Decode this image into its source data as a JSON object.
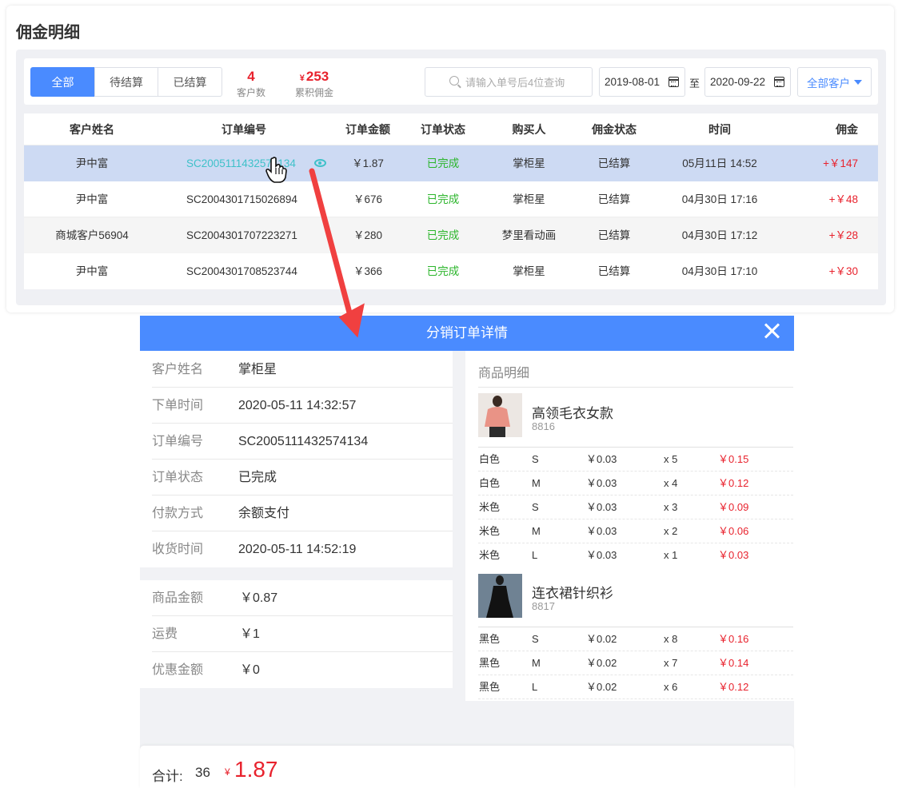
{
  "page_title": "佣金明细",
  "tabs": [
    {
      "label": "全部",
      "active": true
    },
    {
      "label": "待结算",
      "active": false
    },
    {
      "label": "已结算",
      "active": false
    }
  ],
  "stats": {
    "customers": {
      "value": "4",
      "label": "客户数"
    },
    "commission": {
      "currency": "¥",
      "value": "253",
      "label": "累积佣金"
    }
  },
  "search": {
    "placeholder": "请输入单号后4位查询"
  },
  "date_range": {
    "start": "2019-08-01",
    "separator": "至",
    "end": "2020-09-22"
  },
  "customer_filter": {
    "selected": "全部客户"
  },
  "table": {
    "headers": [
      "客户姓名",
      "订单编号",
      "订单金额",
      "订单状态",
      "购买人",
      "佣金状态",
      "时间",
      "佣金"
    ],
    "rows": [
      {
        "name": "尹中富",
        "order": "SC2005111432574134",
        "amount": "￥1.87",
        "status": "已完成",
        "buyer": "掌柜星",
        "cstatus": "已结算",
        "time": "05月11日 14:52",
        "commission": "+￥147"
      },
      {
        "name": "尹中富",
        "order": "SC2004301715026894",
        "amount": "￥676",
        "status": "已完成",
        "buyer": "掌柜星",
        "cstatus": "已结算",
        "time": "04月30日 17:16",
        "commission": "+￥48"
      },
      {
        "name": "商城客户56904",
        "order": "SC2004301707223271",
        "amount": "￥280",
        "status": "已完成",
        "buyer": "梦里看动画",
        "cstatus": "已结算",
        "time": "04月30日 17:12",
        "commission": "+￥28"
      },
      {
        "name": "尹中富",
        "order": "SC2004301708523744",
        "amount": "￥366",
        "status": "已完成",
        "buyer": "掌柜星",
        "cstatus": "已结算",
        "time": "04月30日 17:10",
        "commission": "+￥30"
      }
    ]
  },
  "modal": {
    "title": "分销订单详情",
    "info": [
      {
        "key": "客户姓名",
        "value": "掌柜星"
      },
      {
        "key": "下单时间",
        "value": "2020-05-11 14:32:57"
      },
      {
        "key": "订单编号",
        "value": "SC2005111432574134"
      },
      {
        "key": "订单状态",
        "value": "已完成"
      },
      {
        "key": "付款方式",
        "value": "余额支付"
      },
      {
        "key": "收货时间",
        "value": "2020-05-11 14:52:19"
      }
    ],
    "money": [
      {
        "key": "商品金额",
        "value": "￥0.87"
      },
      {
        "key": "运费",
        "value": "￥1"
      },
      {
        "key": "优惠金额",
        "value": "￥0"
      }
    ],
    "goods_title": "商品明细",
    "products": [
      {
        "name": "高领毛衣女款",
        "code": "8816",
        "skus": [
          {
            "color": "白色",
            "size": "S",
            "price": "￥0.03",
            "qty": "x 5",
            "subtotal": "￥0.15"
          },
          {
            "color": "白色",
            "size": "M",
            "price": "￥0.03",
            "qty": "x 4",
            "subtotal": "￥0.12"
          },
          {
            "color": "米色",
            "size": "S",
            "price": "￥0.03",
            "qty": "x 3",
            "subtotal": "￥0.09"
          },
          {
            "color": "米色",
            "size": "M",
            "price": "￥0.03",
            "qty": "x 2",
            "subtotal": "￥0.06"
          },
          {
            "color": "米色",
            "size": "L",
            "price": "￥0.03",
            "qty": "x 1",
            "subtotal": "￥0.03"
          }
        ]
      },
      {
        "name": "连衣裙针织衫",
        "code": "8817",
        "skus": [
          {
            "color": "黑色",
            "size": "S",
            "price": "￥0.02",
            "qty": "x 8",
            "subtotal": "￥0.16"
          },
          {
            "color": "黑色",
            "size": "M",
            "price": "￥0.02",
            "qty": "x 7",
            "subtotal": "￥0.14"
          },
          {
            "color": "黑色",
            "size": "L",
            "price": "￥0.02",
            "qty": "x 6",
            "subtotal": "￥0.12"
          }
        ]
      }
    ],
    "footer": {
      "label": "合计:",
      "count": "36",
      "currency": "¥",
      "amount": "1.87"
    }
  },
  "colors": {
    "accent": "#4a8bff",
    "red": "#e8222d",
    "green": "#2bb52b",
    "link": "#3ec1c9",
    "annotation_arrow": "#f04040"
  },
  "icons": [
    "search-icon",
    "calendar-icon",
    "chevron-down-icon",
    "eye-icon",
    "close-icon",
    "hand-cursor-icon",
    "annotation-arrow"
  ]
}
